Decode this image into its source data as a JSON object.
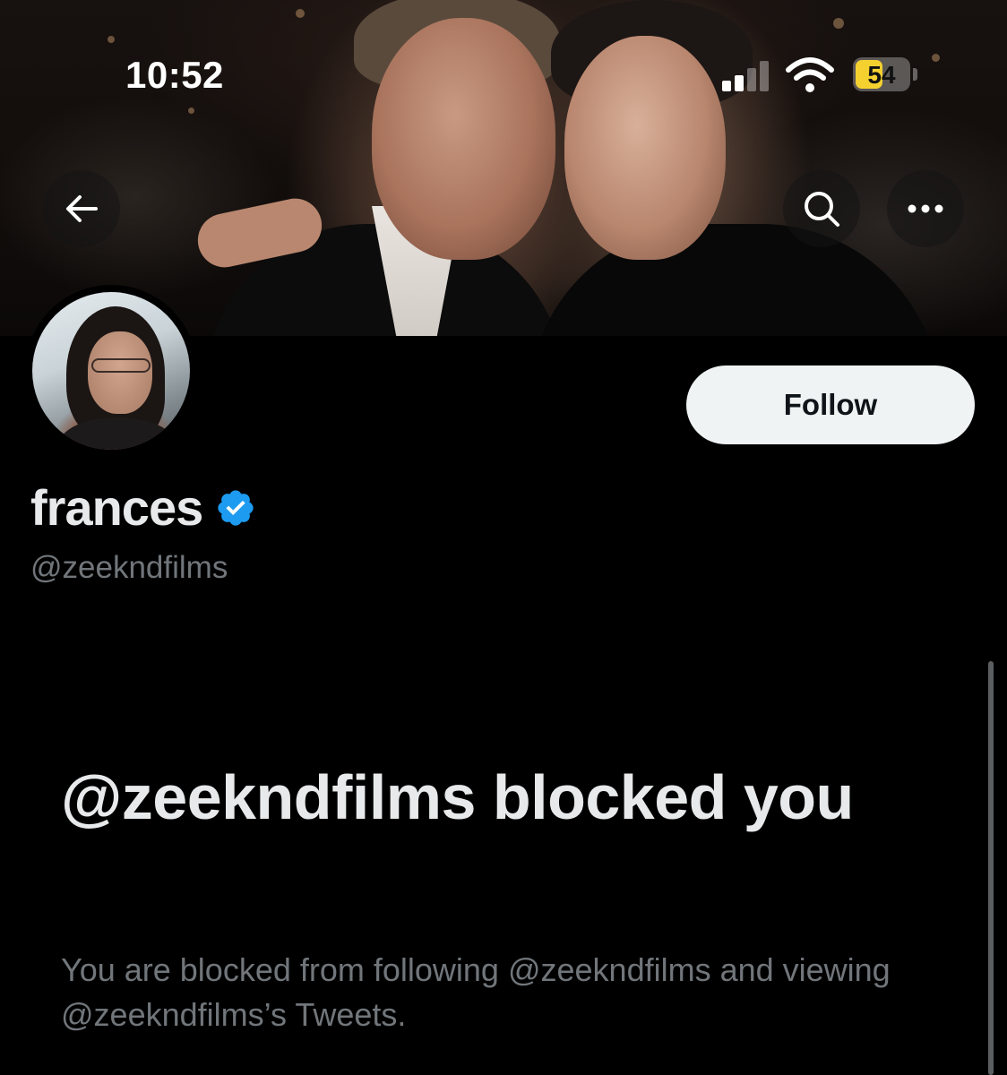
{
  "status_bar": {
    "time": "10:52",
    "battery_level": "54",
    "battery_color": "#f5d130"
  },
  "header": {
    "back_icon": "arrow-left-icon",
    "search_icon": "search-icon",
    "more_icon": "more-horizontal-icon"
  },
  "profile": {
    "display_name": "frances",
    "verified": true,
    "verified_color": "#1d9bf0",
    "handle": "@zeekndfilms",
    "follow_label": "Follow"
  },
  "blocked": {
    "title": "@zeekndfilms blocked you",
    "description": "You are blocked from following @zeekndfilms and viewing @zeekndfilms’s Tweets."
  },
  "colors": {
    "background": "#000000",
    "primary_text": "#e7e9ea",
    "secondary_text": "#71767b",
    "follow_button_bg": "#eff3f4"
  }
}
